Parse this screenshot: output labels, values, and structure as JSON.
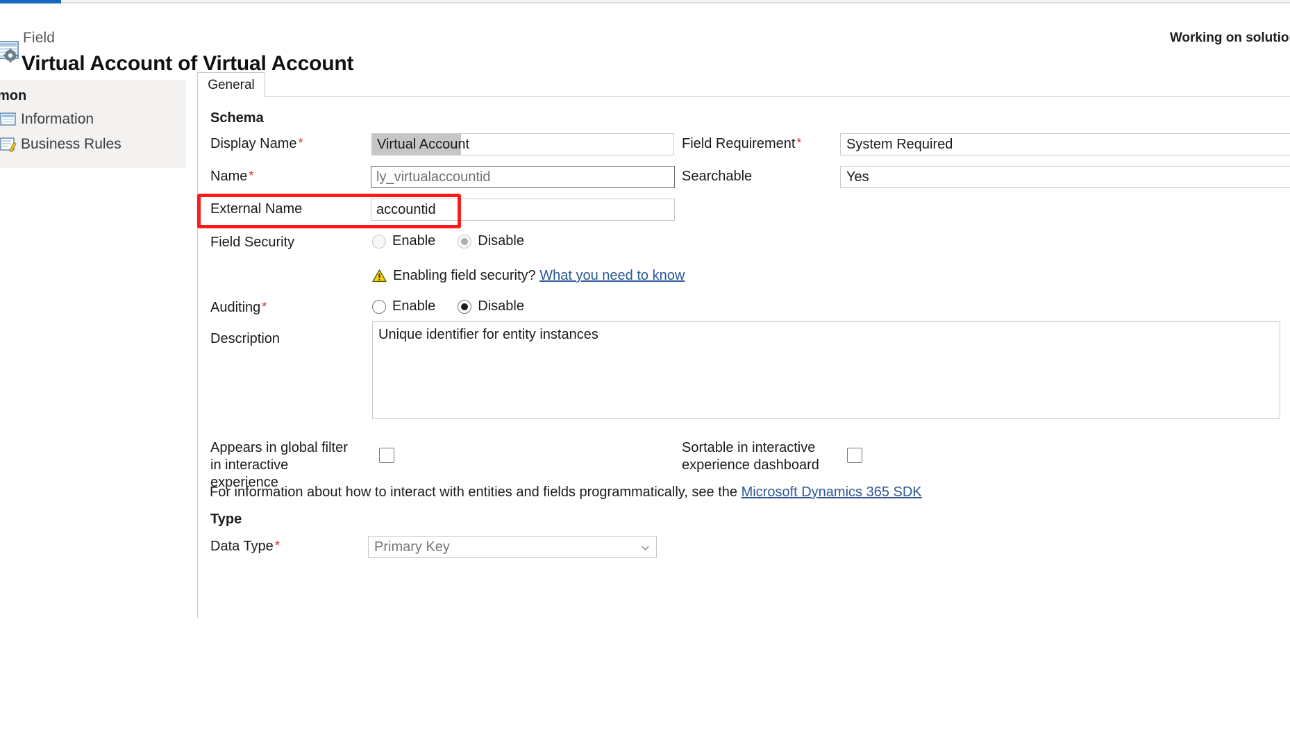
{
  "header": {
    "eyebrow": "Field",
    "title": "Virtual Account of Virtual Account",
    "solution_note": "Working on solution: De",
    "app_icon": "field-entity-icon"
  },
  "sidebar": {
    "group_title": "ommon",
    "items": [
      {
        "label": "Information",
        "icon": "information-page-icon"
      },
      {
        "label": "Business Rules",
        "icon": "business-rules-icon"
      }
    ]
  },
  "tabs": [
    {
      "label": "General",
      "selected": true
    }
  ],
  "form": {
    "schema_heading": "Schema",
    "type_heading": "Type",
    "display_name": {
      "label": "Display Name",
      "required": true,
      "value": "Virtual Account"
    },
    "name": {
      "label": "Name",
      "required": true,
      "value": "ly_virtualaccountid"
    },
    "external_name": {
      "label": "External Name",
      "required": false,
      "value": "accountid"
    },
    "field_requirement": {
      "label": "Field Requirement",
      "required": true,
      "value": "System Required"
    },
    "searchable": {
      "label": "Searchable",
      "required": false,
      "value": "Yes"
    },
    "field_security": {
      "label": "Field Security",
      "options": [
        "Enable",
        "Disable"
      ],
      "selected": "Disable",
      "disabled": true
    },
    "security_warning": {
      "icon": "warning-triangle-icon",
      "text": "Enabling field security?",
      "link_text": "What you need to know"
    },
    "auditing": {
      "label": "Auditing",
      "required": true,
      "options": [
        "Enable",
        "Disable"
      ],
      "selected": "Disable"
    },
    "description": {
      "label": "Description",
      "value": "Unique identifier for entity instances"
    },
    "global_filter": {
      "label": "Appears in global filter in interactive experience",
      "checked": false
    },
    "sortable": {
      "label": "Sortable in interactive experience dashboard",
      "checked": false
    },
    "sdk_note": {
      "text": "For information about how to interact with entities and fields programmatically, see the",
      "link_text": "Microsoft Dynamics 365 SDK"
    },
    "data_type": {
      "label": "Data Type",
      "required": true,
      "value": "Primary Key"
    }
  },
  "annotation": {
    "color": "#ff1a1a",
    "target": "external-name-row"
  }
}
